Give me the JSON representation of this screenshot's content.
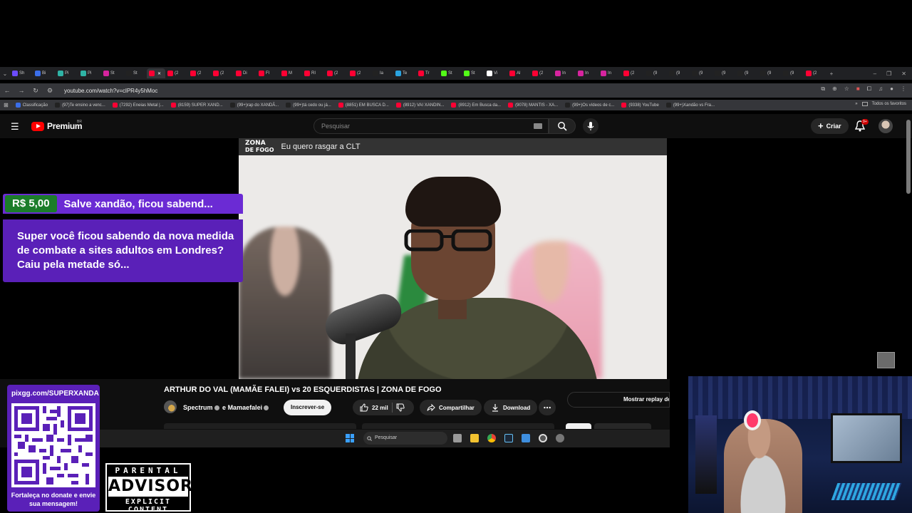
{
  "browser": {
    "tabs": [
      {
        "label": "Sh",
        "color": "#6c4cff"
      },
      {
        "label": "Bi",
        "color": "#3b6ee8"
      },
      {
        "label": "Pi",
        "color": "#2fb3a5"
      },
      {
        "label": "Pi",
        "color": "#2fb3a5"
      },
      {
        "label": "St",
        "color": "#d6249f"
      },
      {
        "label": "St",
        "color": "#222222"
      },
      {
        "label": "",
        "color": "#ff0033",
        "active": true
      },
      {
        "label": "(2",
        "color": "#ff0033"
      },
      {
        "label": "(2",
        "color": "#ff0033"
      },
      {
        "label": "(2",
        "color": "#ff0033"
      },
      {
        "label": "Di",
        "color": "#ff0033"
      },
      {
        "label": "Fl",
        "color": "#ff0033"
      },
      {
        "label": "M",
        "color": "#ff0033"
      },
      {
        "label": "RI",
        "color": "#ff0033"
      },
      {
        "label": "(2",
        "color": "#ff0033"
      },
      {
        "label": "(2",
        "color": "#ff0033"
      },
      {
        "label": "Ia",
        "color": "#222222"
      },
      {
        "label": "Te",
        "color": "#2aa3e0"
      },
      {
        "label": "Tr",
        "color": "#ff0033"
      },
      {
        "label": "St",
        "color": "#53fc18"
      },
      {
        "label": "St",
        "color": "#53fc18"
      },
      {
        "label": "Vi",
        "color": "#ffffff"
      },
      {
        "label": "Al",
        "color": "#ff0033"
      },
      {
        "label": "(2",
        "color": "#ff0033"
      },
      {
        "label": "In",
        "color": "#d6249f"
      },
      {
        "label": "In",
        "color": "#d6249f"
      },
      {
        "label": "In",
        "color": "#d6249f"
      },
      {
        "label": "(2",
        "color": "#ff0033"
      },
      {
        "label": "(9",
        "color": "#222222"
      },
      {
        "label": "(9",
        "color": "#222222"
      },
      {
        "label": "(9",
        "color": "#222222"
      },
      {
        "label": "(9",
        "color": "#222222"
      },
      {
        "label": "(9",
        "color": "#222222"
      },
      {
        "label": "(9",
        "color": "#222222"
      },
      {
        "label": "(9",
        "color": "#222222"
      },
      {
        "label": "(2",
        "color": "#ff0033"
      }
    ],
    "url": "youtube.com/watch?v=clPR4y5hMoc",
    "bookmarks": [
      {
        "label": "Classificação",
        "color": "#3b6ee8"
      },
      {
        "label": "(97)Te ensino a venc...",
        "color": "#222222"
      },
      {
        "label": "(7292) Eneias Metal |...",
        "color": "#ff0033"
      },
      {
        "label": "(8159) SUPER XAND...",
        "color": "#ff0033"
      },
      {
        "label": "(99+)rap do XANDÃ...",
        "color": "#222222"
      },
      {
        "label": "(99+)tá cedo ou já...",
        "color": "#222222"
      },
      {
        "label": "(8851) EM BUSCA D...",
        "color": "#ff0033"
      },
      {
        "label": "(8912) VAI XANDIN...",
        "color": "#ff0033"
      },
      {
        "label": "(8912) Em Busca da...",
        "color": "#ff0033"
      },
      {
        "label": "(9078) MANTIS - XA...",
        "color": "#ff0033"
      },
      {
        "label": "(99+)Os vídeos de c...",
        "color": "#222222"
      },
      {
        "label": "(9338) YouTube",
        "color": "#ff0033"
      },
      {
        "label": "(99+)Xandão vs Fra...",
        "color": "#222222"
      }
    ],
    "all_bookmarks_label": "Todos os favoritos"
  },
  "youtube": {
    "logo_text": "Premium",
    "country": "BR",
    "search_placeholder": "Pesquisar",
    "create_label": "Criar",
    "notif_badge": "9+"
  },
  "player": {
    "overlay_logo_line1": "ZONA",
    "overlay_logo_line2": "DE FOGO",
    "overlay_subtitle": "Eu quero rasgar a CLT"
  },
  "superchat": {
    "amount": "R$ 5,00",
    "title": "Salve xandão, ficou sabend...",
    "message": "Super você ficou sabendo da nova medida de combate a sites adultos em Londres? Caiu pela metade só..."
  },
  "video": {
    "title": "ARTHUR DO VAL (MAMÃE FALEI) vs 20 ESQUERDISTAS | ZONA DE FOGO",
    "channel1": "Spectrum",
    "channel_join": "e",
    "channel2": "Mamaefalei",
    "subscribe_label": "Inscrever-se",
    "likes": "22 mil",
    "share_label": "Compartilhar",
    "download_label": "Download",
    "replay_label": "Mostrar replay do"
  },
  "taskbar": {
    "search_label": "Pesquisar"
  },
  "donate": {
    "url": "pixgg.com/SUPERXANDA",
    "message": "Fortaleça no donate e envie sua mensagem!"
  },
  "advisory": {
    "top": "PARENTAL",
    "mid": "ADVISORY",
    "bottom": "EXPLICIT CONTENT"
  }
}
